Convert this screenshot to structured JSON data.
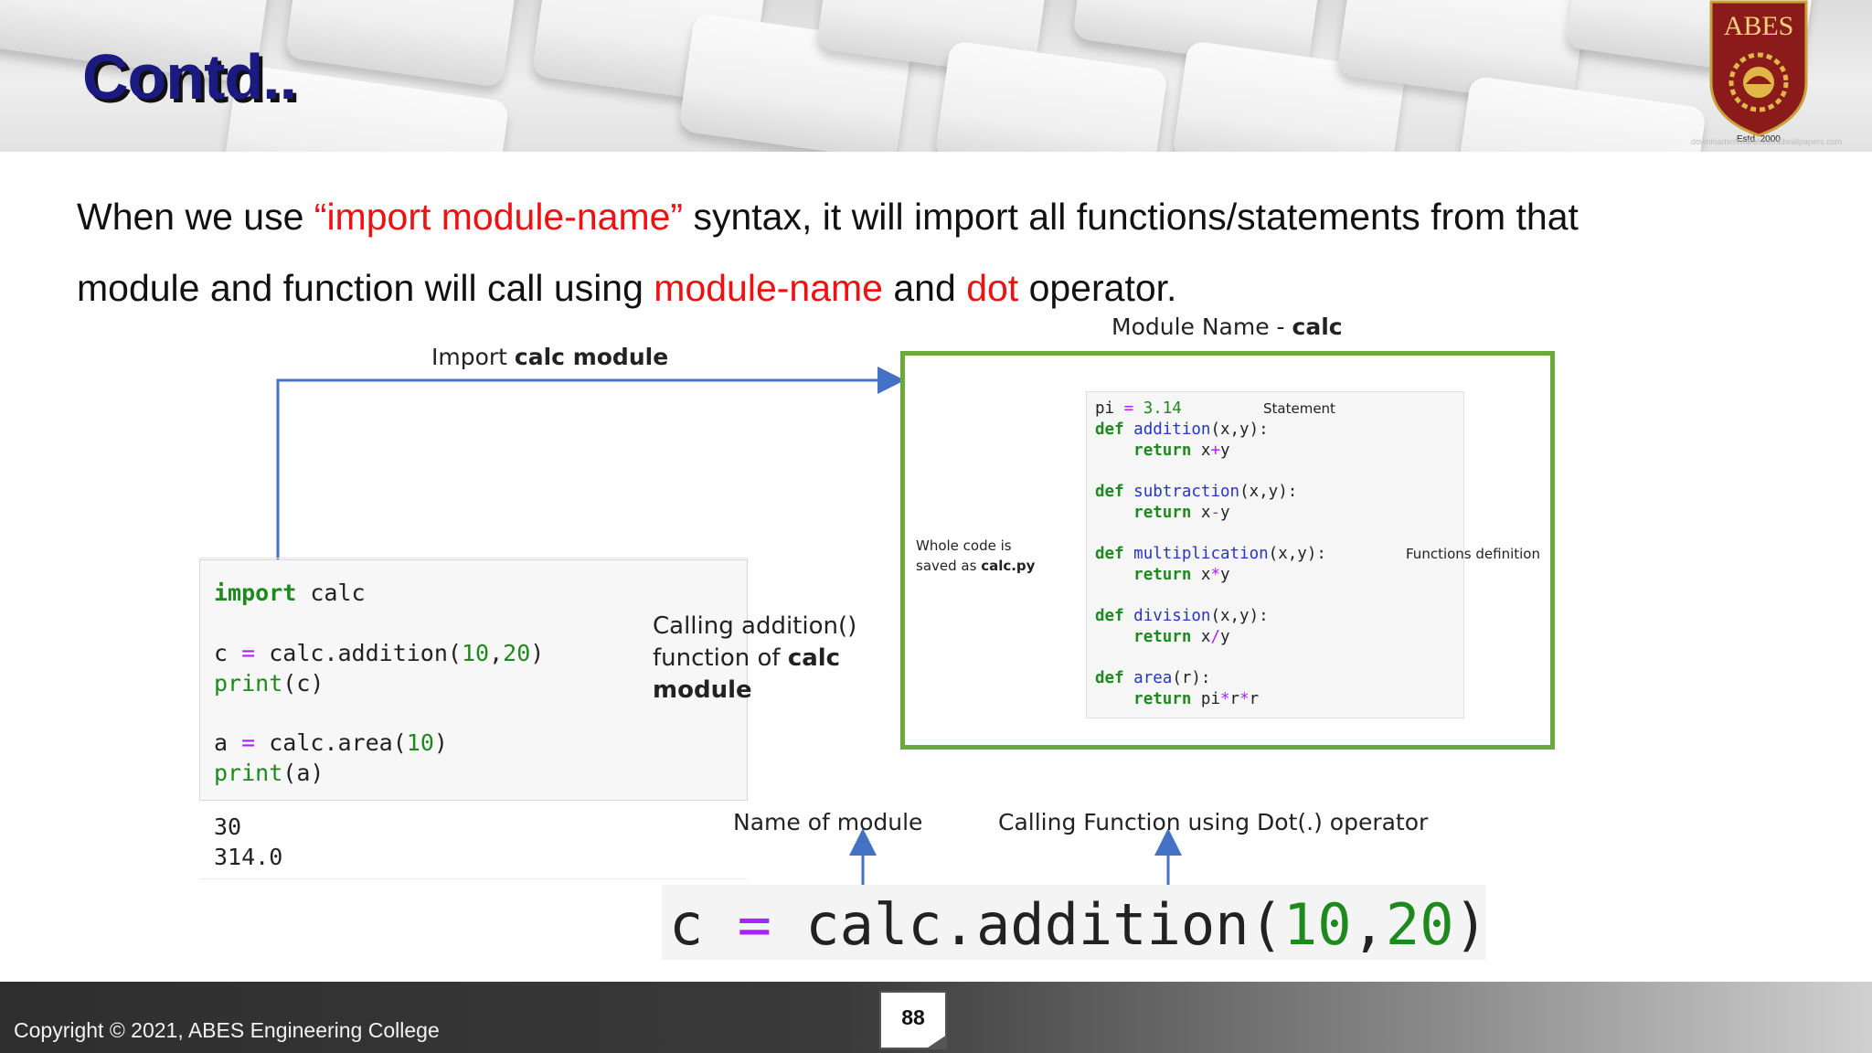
{
  "slide": {
    "title": "Contd..",
    "logo_text": "ABES",
    "logo_est": "Estd. 2000",
    "watermark": "downloadsoftwarefreemidwallpapers.com"
  },
  "body": {
    "line1_a": "When we use ",
    "line1_red": "“import module-name”",
    "line1_b": " syntax, it will import all functions/statements from that",
    "line2_a": "module and function will call using ",
    "line2_red1": "module-name",
    "line2_b": " and ",
    "line2_red2": "dot",
    "line2_c": " operator."
  },
  "diagram": {
    "import_label_a": "Import ",
    "import_label_b": "calc module",
    "module_name_a": "Module Name - ",
    "module_name_b": "calc",
    "calling_label_1": "Calling addition()",
    "calling_label_2a": "function of ",
    "calling_label_2b": "calc",
    "calling_label_3": "module",
    "whole_code_1": "Whole code is",
    "whole_code_2a": "saved as ",
    "whole_code_2b": "calc.py",
    "statement_label": "Statement",
    "functions_label": "Functions definition",
    "name_of_module_label": "Name of module",
    "calling_dot_label": "Calling Function using Dot(.) operator",
    "notebook": {
      "import_kw": "import",
      "import_mod": " calc",
      "line_c": "c",
      "line_c_call": " calc.addition(",
      "line_c_args1": "10",
      "line_c_comma": ",",
      "line_c_args2": "20",
      "line_c_close": ")",
      "print_c_fn": "print",
      "print_c_arg": "(c)",
      "line_a": "a",
      "line_a_call": " calc.area(",
      "line_a_arg": "10",
      "line_a_close": ")",
      "print_a_fn": "print",
      "print_a_arg": "(a)",
      "eq": "=",
      "output_1": "30",
      "output_2": "314.0"
    },
    "module_code": {
      "pi_var": "pi ",
      "pi_eq": "=",
      "pi_val": " 3.14",
      "def": "def",
      "fn1": "addition",
      "fn2": "subtraction",
      "fn3": "multiplication",
      "fn4": "division",
      "fn5": "area",
      "params_xy": "(x,y):",
      "params_r": "(r):",
      "ret": "return",
      "ret1_a": " x",
      "ret1_op": "+",
      "ret1_b": "y",
      "ret2_a": " x",
      "ret2_op": "-",
      "ret2_b": "y",
      "ret3_a": " x",
      "ret3_op": "*",
      "ret3_b": "y",
      "ret4_a": " x",
      "ret4_op": "/",
      "ret4_b": "y",
      "ret5_a": " pi",
      "ret5_op1": "*",
      "ret5_b": "r",
      "ret5_op2": "*",
      "ret5_c": "r"
    },
    "big_line": {
      "var": "c ",
      "eq": "=",
      "call": " calc.addition(",
      "arg1": "10",
      "comma": ",",
      "arg2": "20",
      "close": ")"
    }
  },
  "footer": {
    "copyright": "Copyright © 2021, ABES Engineering College",
    "page_number": "88"
  },
  "colors": {
    "title_blue": "#1a1a80",
    "highlight_red": "#ee1111",
    "module_box_green": "#6aaa3a",
    "arrow_blue": "#4472c4"
  }
}
